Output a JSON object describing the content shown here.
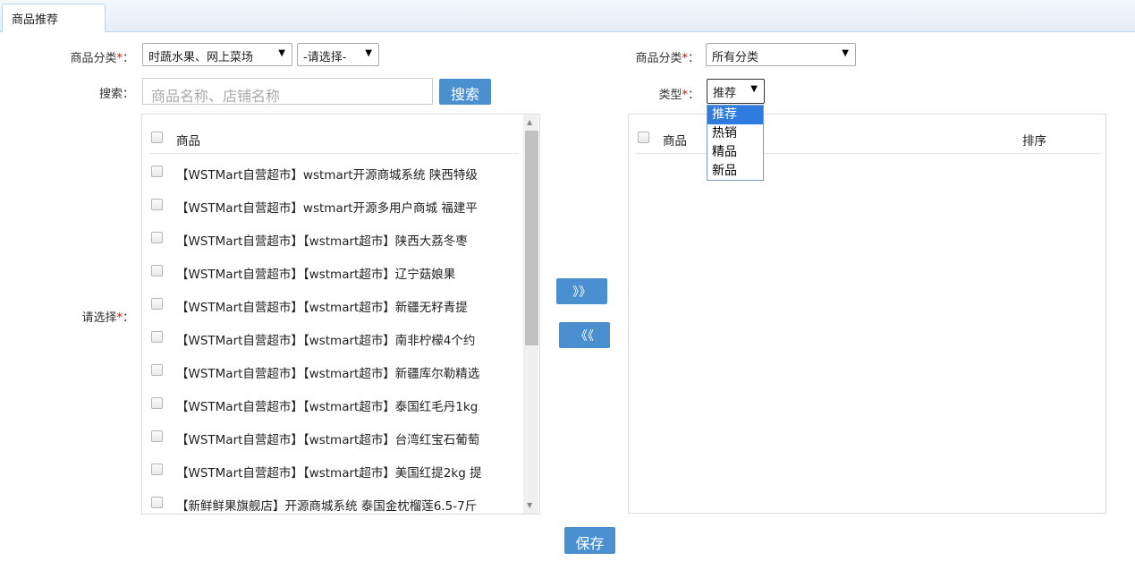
{
  "tab": {
    "label": "商品推荐"
  },
  "left": {
    "category_label": "商品分类",
    "category_value1": "时蔬水果、网上菜场",
    "category_value2": "-请选择-",
    "search_label": "搜索：",
    "search_placeholder": "商品名称、店铺名称",
    "search_button": "搜索",
    "choose_label": "请选择",
    "list_header": "商品",
    "items": [
      "【WSTMart自营超市】wstmart开源商城系统 陕西特级",
      "【WSTMart自营超市】wstmart开源多用户商城 福建平",
      "【WSTMart自营超市】【wstmart超市】陕西大荔冬枣",
      "【WSTMart自营超市】【wstmart超市】辽宁菇娘果",
      "【WSTMart自营超市】【wstmart超市】新疆无籽青提",
      "【WSTMart自营超市】【wstmart超市】南非柠檬4个约",
      "【WSTMart自营超市】【wstmart超市】新疆库尔勒精选",
      "【WSTMart自营超市】【wstmart超市】泰国红毛丹1kg",
      "【WSTMart自营超市】【wstmart超市】台湾红宝石葡萄",
      "【WSTMart自营超市】【wstmart超市】美国红提2kg 提",
      "【新鲜鲜果旗舰店】开源商城系统 泰国金枕榴莲6.5-7斤"
    ]
  },
  "move": {
    "right": "》》",
    "left": "《《"
  },
  "right": {
    "category_label": "商品分类",
    "category_value": "所有分类",
    "type_label": "类型",
    "type_value": "推荐",
    "type_options": [
      "推荐",
      "热销",
      "精品",
      "新品"
    ],
    "col_goods": "商品",
    "col_sort": "排序"
  },
  "colon": "：",
  "required_mark": "*",
  "save_button": "保存"
}
